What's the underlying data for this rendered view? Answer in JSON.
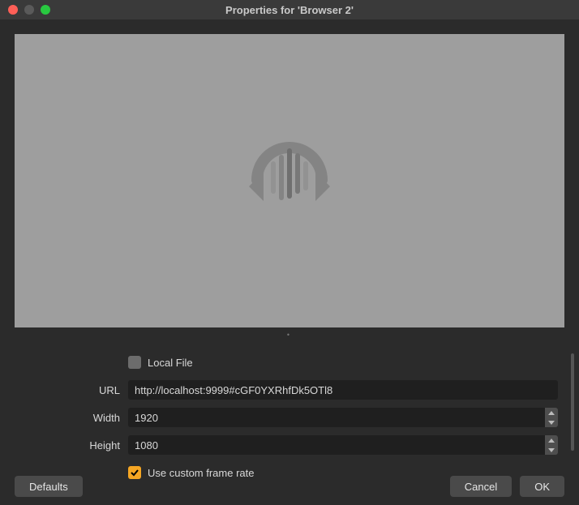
{
  "window": {
    "title": "Properties for 'Browser 2'"
  },
  "form": {
    "local_file": {
      "label": "Local File",
      "checked": false
    },
    "url": {
      "label": "URL",
      "value": "http://localhost:9999#cGF0YXRhfDk5OTl8"
    },
    "width": {
      "label": "Width",
      "value": "1920"
    },
    "height": {
      "label": "Height",
      "value": "1080"
    },
    "custom_frame_rate": {
      "label": "Use custom frame rate",
      "checked": true
    }
  },
  "buttons": {
    "defaults": "Defaults",
    "cancel": "Cancel",
    "ok": "OK"
  }
}
